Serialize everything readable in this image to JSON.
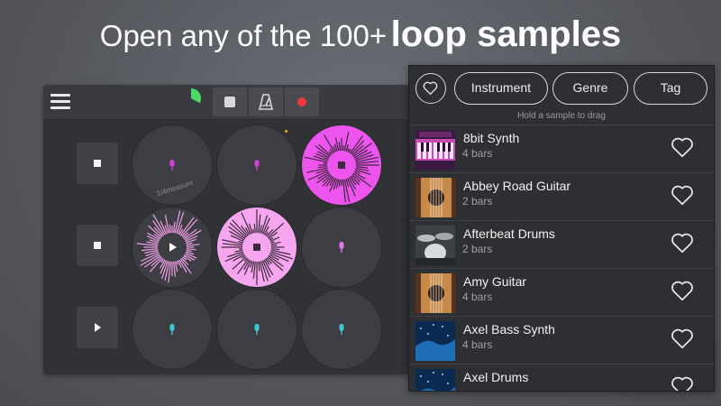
{
  "headline": {
    "prefix": "Open any of the 100+",
    "emphasis": "loop samples"
  },
  "loop_machine": {
    "toolbar": {
      "menu_icon": "hamburger-menu-icon",
      "progress_icon": "loop-progress-icon",
      "progress_fraction": 0.33,
      "buttons": [
        {
          "name": "stop",
          "icon": "stop-icon"
        },
        {
          "name": "metronome",
          "icon": "metronome-icon"
        },
        {
          "name": "record",
          "icon": "record-icon",
          "color": "#ef3b3b"
        }
      ]
    },
    "rows": [
      {
        "control": "stop",
        "icon": "stop-icon"
      },
      {
        "control": "stop",
        "icon": "stop-icon"
      },
      {
        "control": "play",
        "icon": "play-icon"
      }
    ],
    "pads": [
      {
        "state": "idle",
        "color": "#d63fd6",
        "icon": "mic-icon",
        "label": "1/4measure"
      },
      {
        "state": "idle",
        "color": "#d63fd6",
        "icon": "mic-icon",
        "label": ""
      },
      {
        "state": "playing",
        "color": "#ee55ee",
        "icon": "stop-icon",
        "label": ""
      },
      {
        "state": "queued",
        "color": "#f2a0e8",
        "icon": "play-icon",
        "label": ""
      },
      {
        "state": "playing",
        "color": "#f5a6ee",
        "icon": "stop-icon",
        "label": ""
      },
      {
        "state": "idle",
        "color": "#e07ae0",
        "icon": "mic-icon",
        "label": ""
      },
      {
        "state": "idle",
        "color": "#3fc9d6",
        "icon": "mic-icon",
        "label": ""
      },
      {
        "state": "idle",
        "color": "#3fc9d6",
        "icon": "mic-icon",
        "label": ""
      },
      {
        "state": "idle",
        "color": "#3fc9d6",
        "icon": "mic-icon",
        "label": ""
      }
    ]
  },
  "browser": {
    "favorites_icon": "heart-outline-icon",
    "filters": [
      "Instrument",
      "Genre",
      "Tag"
    ],
    "hint": "Hold a sample to drag",
    "samples": [
      {
        "name": "8bit Synth",
        "length": "4 bars",
        "thumb": "synth"
      },
      {
        "name": "Abbey Road Guitar",
        "length": "2 bars",
        "thumb": "guitar"
      },
      {
        "name": "Afterbeat Drums",
        "length": "2 bars",
        "thumb": "drums"
      },
      {
        "name": "Amy Guitar",
        "length": "4 bars",
        "thumb": "guitar"
      },
      {
        "name": "Axel Bass Synth",
        "length": "4 bars",
        "thumb": "space"
      },
      {
        "name": "Axel Drums",
        "length": "",
        "thumb": "space"
      }
    ]
  },
  "colors": {
    "accent_green": "#4cd964",
    "pink": "#f5a6ee",
    "magenta": "#ee55ee",
    "cyan": "#3fc9d6",
    "record_red": "#ef3b3b"
  }
}
